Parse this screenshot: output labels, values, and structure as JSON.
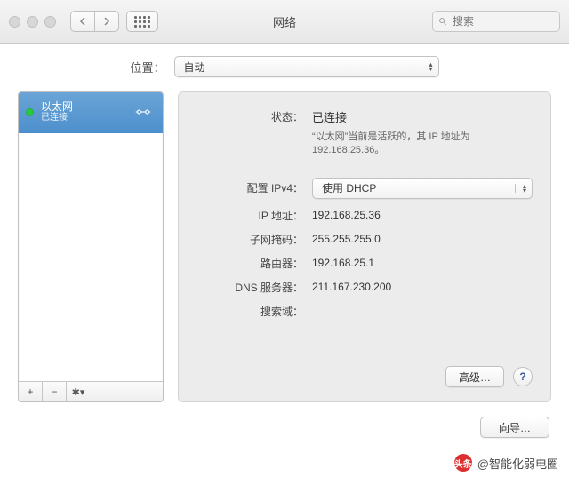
{
  "window": {
    "title": "网络",
    "search_placeholder": "搜索"
  },
  "location": {
    "label": "位置：",
    "value": "自动"
  },
  "sidebar": {
    "item": {
      "name": "以太网",
      "status": "已连接"
    },
    "tools": {
      "plus": "+",
      "minus": "−",
      "gear": "✱▾"
    }
  },
  "detail": {
    "status": {
      "label": "状态：",
      "value": "已连接",
      "note": "“以太网”当前是活跃的，其 IP 地址为 192.168.25.36。"
    },
    "ipv4": {
      "label": "配置 IPv4：",
      "value": "使用 DHCP"
    },
    "ip": {
      "label": "IP 地址：",
      "value": "192.168.25.36"
    },
    "mask": {
      "label": "子网掩码：",
      "value": "255.255.255.0"
    },
    "router": {
      "label": "路由器：",
      "value": "192.168.25.1"
    },
    "dns": {
      "label": "DNS 服务器：",
      "value": "211.167.230.200"
    },
    "search": {
      "label": "搜索域：",
      "value": ""
    },
    "advanced": "高级…",
    "help": "?"
  },
  "footer": {
    "assist": "向导…"
  },
  "attribution": {
    "logo": "头条",
    "text": "@智能化弱电圈"
  }
}
